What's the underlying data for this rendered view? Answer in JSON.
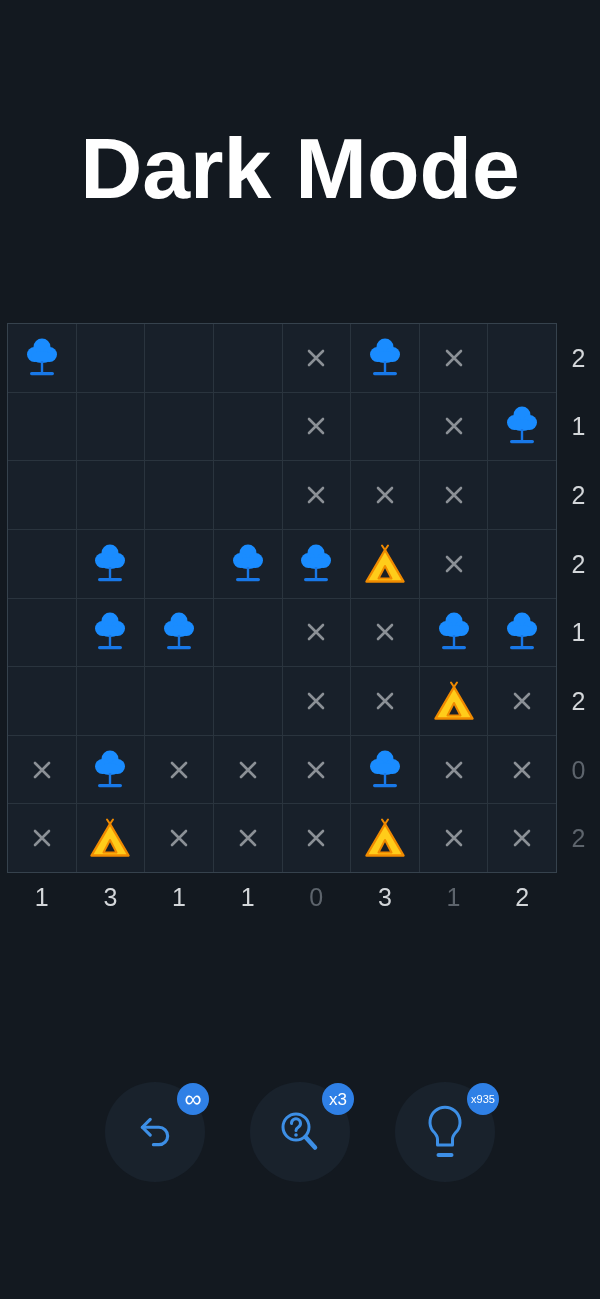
{
  "title": "Dark Mode",
  "grid": {
    "rows": [
      {
        "cells": [
          {
            "kind": "tree"
          },
          {
            "kind": "empty"
          },
          {
            "kind": "empty"
          },
          {
            "kind": "empty"
          },
          {
            "kind": "cross"
          },
          {
            "kind": "tree"
          },
          {
            "kind": "cross"
          },
          {
            "kind": "empty"
          }
        ],
        "clue": {
          "text": "2",
          "satisfied": false
        }
      },
      {
        "cells": [
          {
            "kind": "empty"
          },
          {
            "kind": "empty"
          },
          {
            "kind": "empty"
          },
          {
            "kind": "empty"
          },
          {
            "kind": "cross"
          },
          {
            "kind": "empty"
          },
          {
            "kind": "cross"
          },
          {
            "kind": "tree"
          }
        ],
        "clue": {
          "text": "1",
          "satisfied": false
        }
      },
      {
        "cells": [
          {
            "kind": "empty"
          },
          {
            "kind": "empty"
          },
          {
            "kind": "empty"
          },
          {
            "kind": "empty"
          },
          {
            "kind": "cross"
          },
          {
            "kind": "cross"
          },
          {
            "kind": "cross"
          },
          {
            "kind": "empty"
          }
        ],
        "clue": {
          "text": "2",
          "satisfied": false
        }
      },
      {
        "cells": [
          {
            "kind": "empty"
          },
          {
            "kind": "tree"
          },
          {
            "kind": "empty"
          },
          {
            "kind": "tree"
          },
          {
            "kind": "tree"
          },
          {
            "kind": "tent"
          },
          {
            "kind": "cross"
          },
          {
            "kind": "empty"
          }
        ],
        "clue": {
          "text": "2",
          "satisfied": false
        }
      },
      {
        "cells": [
          {
            "kind": "empty"
          },
          {
            "kind": "tree"
          },
          {
            "kind": "tree"
          },
          {
            "kind": "empty"
          },
          {
            "kind": "cross"
          },
          {
            "kind": "cross"
          },
          {
            "kind": "tree"
          },
          {
            "kind": "tree"
          }
        ],
        "clue": {
          "text": "1",
          "satisfied": false
        }
      },
      {
        "cells": [
          {
            "kind": "empty"
          },
          {
            "kind": "empty"
          },
          {
            "kind": "empty"
          },
          {
            "kind": "empty"
          },
          {
            "kind": "cross"
          },
          {
            "kind": "cross"
          },
          {
            "kind": "tent"
          },
          {
            "kind": "cross"
          }
        ],
        "clue": {
          "text": "2",
          "satisfied": false
        }
      },
      {
        "cells": [
          {
            "kind": "cross"
          },
          {
            "kind": "tree"
          },
          {
            "kind": "cross"
          },
          {
            "kind": "cross"
          },
          {
            "kind": "cross"
          },
          {
            "kind": "tree"
          },
          {
            "kind": "cross"
          },
          {
            "kind": "cross"
          }
        ],
        "clue": {
          "text": "0",
          "satisfied": true
        }
      },
      {
        "cells": [
          {
            "kind": "cross"
          },
          {
            "kind": "tent"
          },
          {
            "kind": "cross"
          },
          {
            "kind": "cross"
          },
          {
            "kind": "cross"
          },
          {
            "kind": "tent"
          },
          {
            "kind": "cross"
          },
          {
            "kind": "cross"
          }
        ],
        "clue": {
          "text": "2",
          "satisfied": true
        }
      }
    ],
    "column_clues": [
      {
        "text": "1",
        "satisfied": false
      },
      {
        "text": "3",
        "satisfied": false
      },
      {
        "text": "1",
        "satisfied": false
      },
      {
        "text": "1",
        "satisfied": false
      },
      {
        "text": "0",
        "satisfied": true
      },
      {
        "text": "3",
        "satisfied": false
      },
      {
        "text": "1",
        "satisfied": true
      },
      {
        "text": "2",
        "satisfied": false
      }
    ]
  },
  "tools": [
    {
      "kind": "undo",
      "badge": "∞"
    },
    {
      "kind": "magnifier",
      "badge": "x3"
    },
    {
      "kind": "hint",
      "badge": "x935"
    }
  ]
}
